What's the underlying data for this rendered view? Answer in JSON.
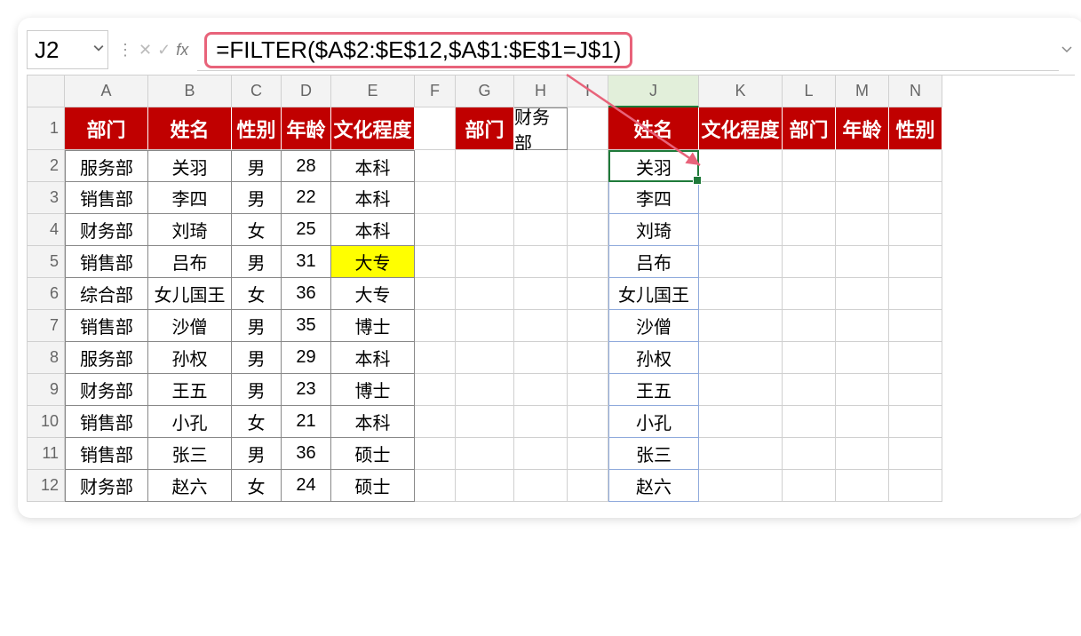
{
  "nameBox": "J2",
  "formula": "=FILTER($A$2:$E$12,$A$1:$E$1=J$1)",
  "columns": [
    "A",
    "B",
    "C",
    "D",
    "E",
    "F",
    "G",
    "H",
    "I",
    "J",
    "K",
    "L",
    "M",
    "N"
  ],
  "rows": [
    1,
    2,
    3,
    4,
    5,
    6,
    7,
    8,
    9,
    10,
    11,
    12
  ],
  "headers1": {
    "A": "部门",
    "B": "姓名",
    "C": "性别",
    "D": "年龄",
    "E": "文化程度",
    "G": "部门",
    "H": "财务部",
    "J": "姓名",
    "K": "文化程度",
    "L": "部门",
    "M": "年龄",
    "N": "性别"
  },
  "table": [
    {
      "A": "服务部",
      "B": "关羽",
      "C": "男",
      "D": "28",
      "E": "本科"
    },
    {
      "A": "销售部",
      "B": "李四",
      "C": "男",
      "D": "22",
      "E": "本科"
    },
    {
      "A": "财务部",
      "B": "刘琦",
      "C": "女",
      "D": "25",
      "E": "本科"
    },
    {
      "A": "销售部",
      "B": "吕布",
      "C": "男",
      "D": "31",
      "E": "大专",
      "hlE": true
    },
    {
      "A": "综合部",
      "B": "女儿国王",
      "C": "女",
      "D": "36",
      "E": "大专"
    },
    {
      "A": "销售部",
      "B": "沙僧",
      "C": "男",
      "D": "35",
      "E": "博士"
    },
    {
      "A": "服务部",
      "B": "孙权",
      "C": "男",
      "D": "29",
      "E": "本科"
    },
    {
      "A": "财务部",
      "B": "王五",
      "C": "男",
      "D": "23",
      "E": "博士"
    },
    {
      "A": "销售部",
      "B": "小孔",
      "C": "女",
      "D": "21",
      "E": "本科"
    },
    {
      "A": "销售部",
      "B": "张三",
      "C": "男",
      "D": "36",
      "E": "硕士"
    },
    {
      "A": "财务部",
      "B": "赵六",
      "C": "女",
      "D": "24",
      "E": "硕士"
    }
  ],
  "spillJ": [
    "关羽",
    "李四",
    "刘琦",
    "吕布",
    "女儿国王",
    "沙僧",
    "孙权",
    "王五",
    "小孔",
    "张三",
    "赵六"
  ]
}
